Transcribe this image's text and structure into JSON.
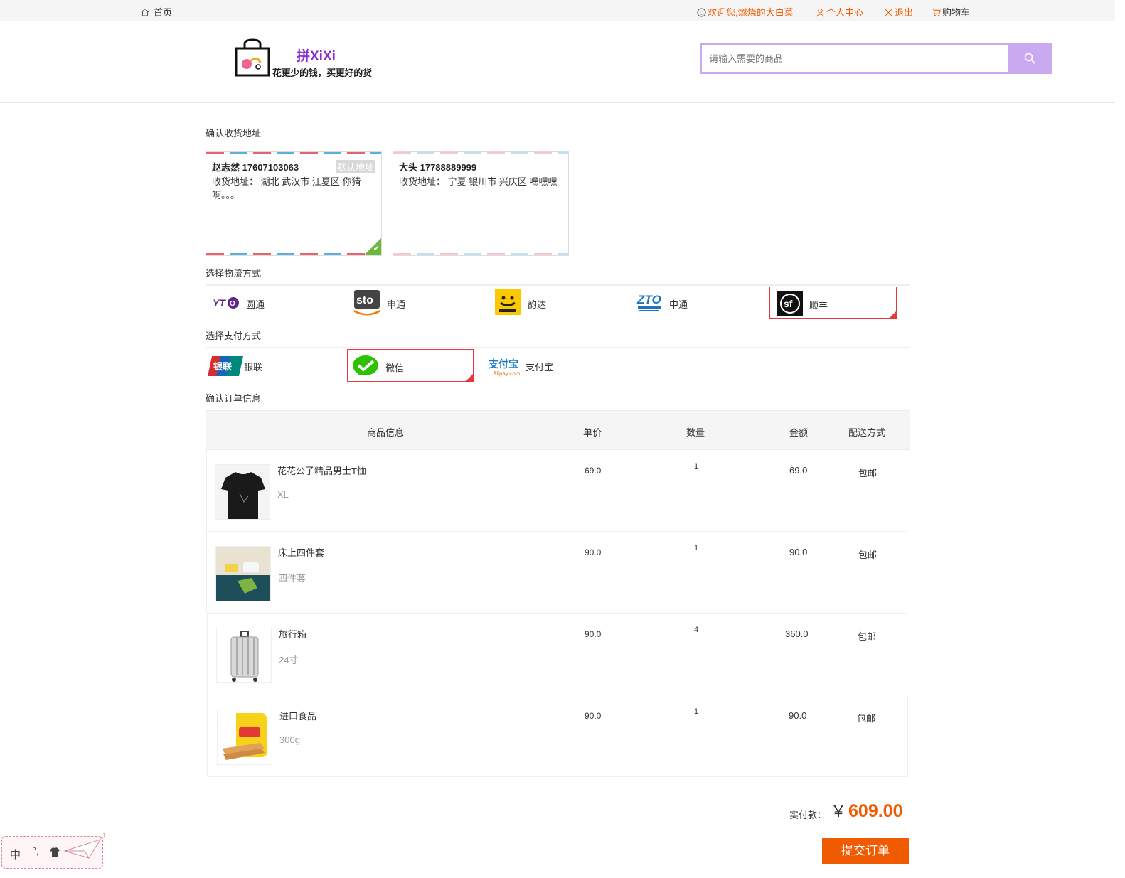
{
  "topbar": {
    "home": "首页",
    "welcome": "欢迎您,燃烧的大白菜",
    "user_center": "个人中心",
    "logout": "退出",
    "cart": "购物车",
    "accent_color": "#f05a00"
  },
  "header": {
    "brand": "拼XiXi",
    "slogan": "花更少的钱，买更好的货",
    "search_placeholder": "请输入需要的商品",
    "search_color": "#c9aaf0"
  },
  "address_section": {
    "title": "确认收货地址",
    "addresses": [
      {
        "name_phone": "赵志然 17607103063",
        "label": "收货地址：",
        "address": "湖北 武汉市 江夏区 你猜啊。。。",
        "badge": "默认地址",
        "selected": true
      },
      {
        "name_phone": "大头 17788889999",
        "label": "收货地址：",
        "address": "宁夏 银川市 兴庆区 嘿嘿嘿",
        "selected": false
      }
    ]
  },
  "logistics_section": {
    "title": "选择物流方式",
    "options": [
      {
        "label": "圆通",
        "icon": "yto-logo-icon",
        "selected": false
      },
      {
        "label": "申通",
        "icon": "sto-logo-icon",
        "selected": false
      },
      {
        "label": "韵达",
        "icon": "yunda-logo-icon",
        "selected": false
      },
      {
        "label": "中通",
        "icon": "zto-logo-icon",
        "selected": false
      },
      {
        "label": "顺丰",
        "icon": "sf-logo-icon",
        "selected": true
      }
    ]
  },
  "payment_section": {
    "title": "选择支付方式",
    "options": [
      {
        "label": "银联",
        "icon": "unionpay-logo-icon",
        "selected": false
      },
      {
        "label": "微信",
        "icon": "wechat-logo-icon",
        "selected": true
      },
      {
        "label": "支付宝",
        "icon": "alipay-logo-icon",
        "selected": false
      }
    ]
  },
  "order_section": {
    "title": "确认订单信息",
    "columns": [
      "商品信息",
      "单价",
      "数量",
      "金额",
      "配送方式"
    ],
    "items": [
      {
        "name": "花花公子精品男士T恤",
        "spec": "XL",
        "price": "69.0",
        "qty": "1",
        "amount": "69.0",
        "shipping": "包邮",
        "image": "tshirt-image"
      },
      {
        "name": "床上四件套",
        "spec": "四件套",
        "price": "90.0",
        "qty": "1",
        "amount": "90.0",
        "shipping": "包邮",
        "image": "bedding-image"
      },
      {
        "name": "旅行箱",
        "spec": "24寸",
        "price": "90.0",
        "qty": "4",
        "amount": "360.0",
        "shipping": "包邮",
        "image": "suitcase-image"
      },
      {
        "name": "进口食品",
        "spec": "300g",
        "price": "90.0",
        "qty": "1",
        "amount": "90.0",
        "shipping": "包邮",
        "image": "snack-image"
      }
    ]
  },
  "summary": {
    "pay_label": "实付款：",
    "currency": "￥",
    "total": "609.00",
    "submit": "提交订单"
  },
  "ime": {
    "mode": "中",
    "punct": "°,"
  }
}
